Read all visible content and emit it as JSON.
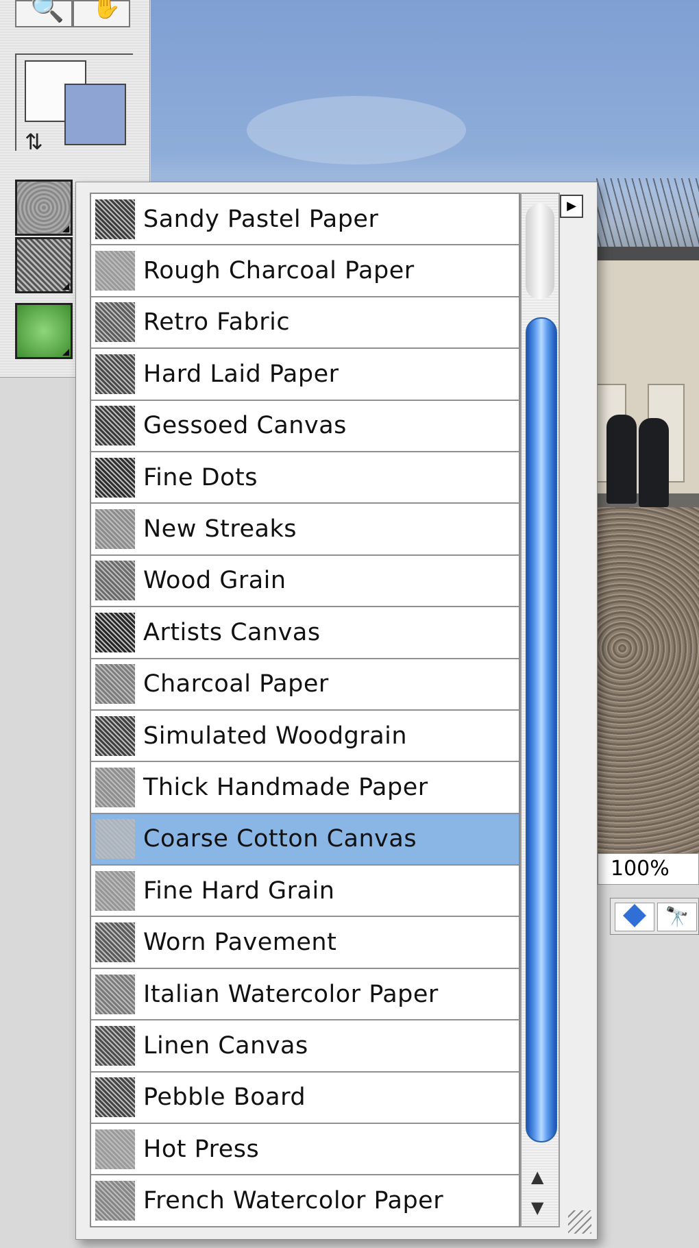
{
  "zoom": {
    "value": "100%"
  },
  "popup": {
    "selected_index": 12,
    "items": [
      {
        "label": "Sandy Pastel Paper",
        "texture": "#3d3d3d"
      },
      {
        "label": "Rough Charcoal Paper",
        "texture": "#9a9a9a"
      },
      {
        "label": "Retro Fabric",
        "texture": "#5c5c5c"
      },
      {
        "label": "Hard Laid Paper",
        "texture": "#4a4a4a"
      },
      {
        "label": "Gessoed Canvas",
        "texture": "#3a3a3a"
      },
      {
        "label": "Fine Dots",
        "texture": "#2e2e2e"
      },
      {
        "label": "New Streaks",
        "texture": "#8c8c8c"
      },
      {
        "label": "Wood Grain",
        "texture": "#6a6a6a"
      },
      {
        "label": "Artists Canvas",
        "texture": "#262626"
      },
      {
        "label": "Charcoal Paper",
        "texture": "#7d7d7d"
      },
      {
        "label": "Simulated Woodgrain",
        "texture": "#3f3f3f"
      },
      {
        "label": "Thick Handmade Paper",
        "texture": "#8e8e8e"
      },
      {
        "label": "Coarse Cotton Canvas",
        "texture": "#a7b4c4"
      },
      {
        "label": "Fine Hard Grain",
        "texture": "#969696"
      },
      {
        "label": "Worn Pavement",
        "texture": "#5a5a5a"
      },
      {
        "label": "Italian Watercolor Paper",
        "texture": "#7a7a7a"
      },
      {
        "label": "Linen Canvas",
        "texture": "#4d4d4d"
      },
      {
        "label": "Pebble Board",
        "texture": "#444444"
      },
      {
        "label": "Hot Press",
        "texture": "#9b9b9b"
      },
      {
        "label": "French Watercolor Paper",
        "texture": "#858585"
      }
    ]
  }
}
